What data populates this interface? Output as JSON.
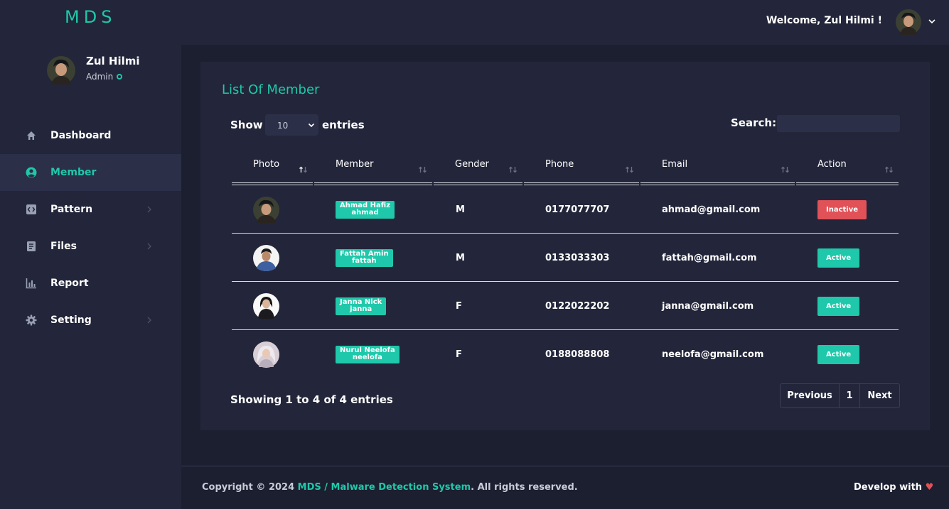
{
  "brand": "MDS",
  "topbar": {
    "welcome": "Welcome, Zul Hilmi !"
  },
  "profile": {
    "name": "Zul Hilmi",
    "role": "Admin"
  },
  "nav": [
    {
      "label": "Dashboard",
      "icon": "home-icon",
      "active": false
    },
    {
      "label": "Member",
      "icon": "user-circle-icon",
      "active": true
    },
    {
      "label": "Pattern",
      "icon": "code-icon",
      "active": false
    },
    {
      "label": "Files",
      "icon": "document-icon",
      "active": false
    },
    {
      "label": "Report",
      "icon": "bar-chart-icon",
      "active": false
    },
    {
      "label": "Setting",
      "icon": "gear-icon",
      "active": false
    }
  ],
  "main": {
    "title": "List Of Member",
    "show_label": "Show",
    "entries_value": "10",
    "entries_label": "entries",
    "search_label": "Search:",
    "search_value": "",
    "columns": [
      "Photo",
      "Member",
      "Gender",
      "Phone",
      "Email",
      "Action"
    ],
    "rows": [
      {
        "name": "Ahmad Hafiz",
        "username": "ahmad",
        "gender": "M",
        "phone": "0177077707",
        "email": "ahmad@gmail.com",
        "status": "Inactive"
      },
      {
        "name": "Fattah Amin",
        "username": "fattah",
        "gender": "M",
        "phone": "0133033303",
        "email": "fattah@gmail.com",
        "status": "Active"
      },
      {
        "name": "Janna Nick",
        "username": "janna",
        "gender": "F",
        "phone": "0122022202",
        "email": "janna@gmail.com",
        "status": "Active"
      },
      {
        "name": "Nurul Neelofa",
        "username": "neelofa",
        "gender": "F",
        "phone": "0188088808",
        "email": "neelofa@gmail.com",
        "status": "Active"
      }
    ],
    "showing": "Showing 1 to 4 of 4 entries",
    "pagination": {
      "previous": "Previous",
      "page": "1",
      "next": "Next"
    }
  },
  "footer": {
    "prefix": "Copyright © 2024 ",
    "link": "MDS / Malware Detection System",
    "suffix": ". All rights reserved.",
    "develop": "Develop with"
  },
  "colors": {
    "accent": "#1fc8aa",
    "inactive": "#e05257",
    "panel": "#23263a",
    "background": "#1c1f30"
  }
}
